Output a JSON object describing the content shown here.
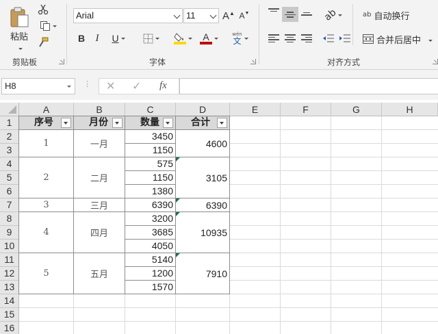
{
  "ribbon": {
    "clipboard": {
      "paste_label": "粘贴",
      "group_label": "剪贴板"
    },
    "font": {
      "font_name": "Arial",
      "font_size": "11",
      "grow_label": "A",
      "shrink_label": "A",
      "bold_label": "B",
      "italic_label": "I",
      "underline_label": "U",
      "phonetic_top": "wén",
      "phonetic_char": "文",
      "fill_color": "#ffd700",
      "font_color": "#c00000",
      "group_label": "字体"
    },
    "alignment": {
      "wrap_icon_text": "ab",
      "wrap_label": "自动换行",
      "merge_label": "合并后居中",
      "group_label": "对齐方式"
    }
  },
  "formula_bar": {
    "name_box": "H8",
    "fx_label": "fx",
    "formula": ""
  },
  "sheet": {
    "columns": [
      "A",
      "B",
      "C",
      "D",
      "E",
      "F",
      "G",
      "H"
    ],
    "rows": [
      "1",
      "2",
      "3",
      "4",
      "5",
      "6",
      "7",
      "8",
      "9",
      "10",
      "11",
      "12",
      "13",
      "14",
      "15",
      "16"
    ],
    "headers": [
      "序号",
      "月份",
      "数量",
      "合计"
    ],
    "groups": [
      {
        "seq": "1",
        "month": "一月",
        "quantities": [
          "3450",
          "1150"
        ],
        "total": "4600"
      },
      {
        "seq": "2",
        "month": "二月",
        "quantities": [
          "575",
          "1150",
          "1380"
        ],
        "total": "3105"
      },
      {
        "seq": "3",
        "month": "三月",
        "quantities": [
          "6390"
        ],
        "total": "6390"
      },
      {
        "seq": "4",
        "month": "四月",
        "quantities": [
          "3200",
          "3685",
          "4050"
        ],
        "total": "10935"
      },
      {
        "seq": "5",
        "month": "五月",
        "quantities": [
          "5140",
          "1200",
          "1570"
        ],
        "total": "7910"
      }
    ],
    "accent_color": "#1e7145"
  }
}
